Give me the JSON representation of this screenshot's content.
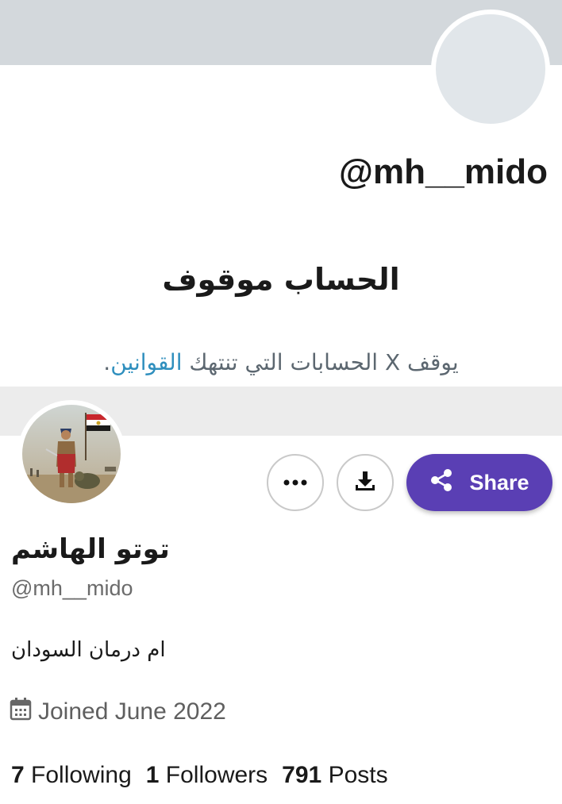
{
  "suspended": {
    "handle": "@mh__mido",
    "title": "الحساب موقوف",
    "note_prefix": "يوقف X الحسابات التي تنتهك ",
    "rules_link": "القوانين",
    "note_suffix": "."
  },
  "profile": {
    "display_name": "توتو الهاشم",
    "username": "@mh__mido",
    "bio": "ام درمان السودان",
    "joined": "Joined June 2022",
    "stats": [
      {
        "count": "7",
        "label": "Following"
      },
      {
        "count": "1",
        "label": "Followers"
      },
      {
        "count": "791",
        "label": "Posts"
      }
    ]
  },
  "actions": {
    "more_icon": "more-horizontal-icon",
    "download_icon": "download-icon",
    "share_icon": "share-icon",
    "share_label": "Share"
  },
  "colors": {
    "banner": "#d3d8dc",
    "share_button": "#5a3fb4",
    "link": "#2f8fbe",
    "divider_band": "#ececec"
  },
  "icons": {
    "joined": "calendar-icon"
  }
}
